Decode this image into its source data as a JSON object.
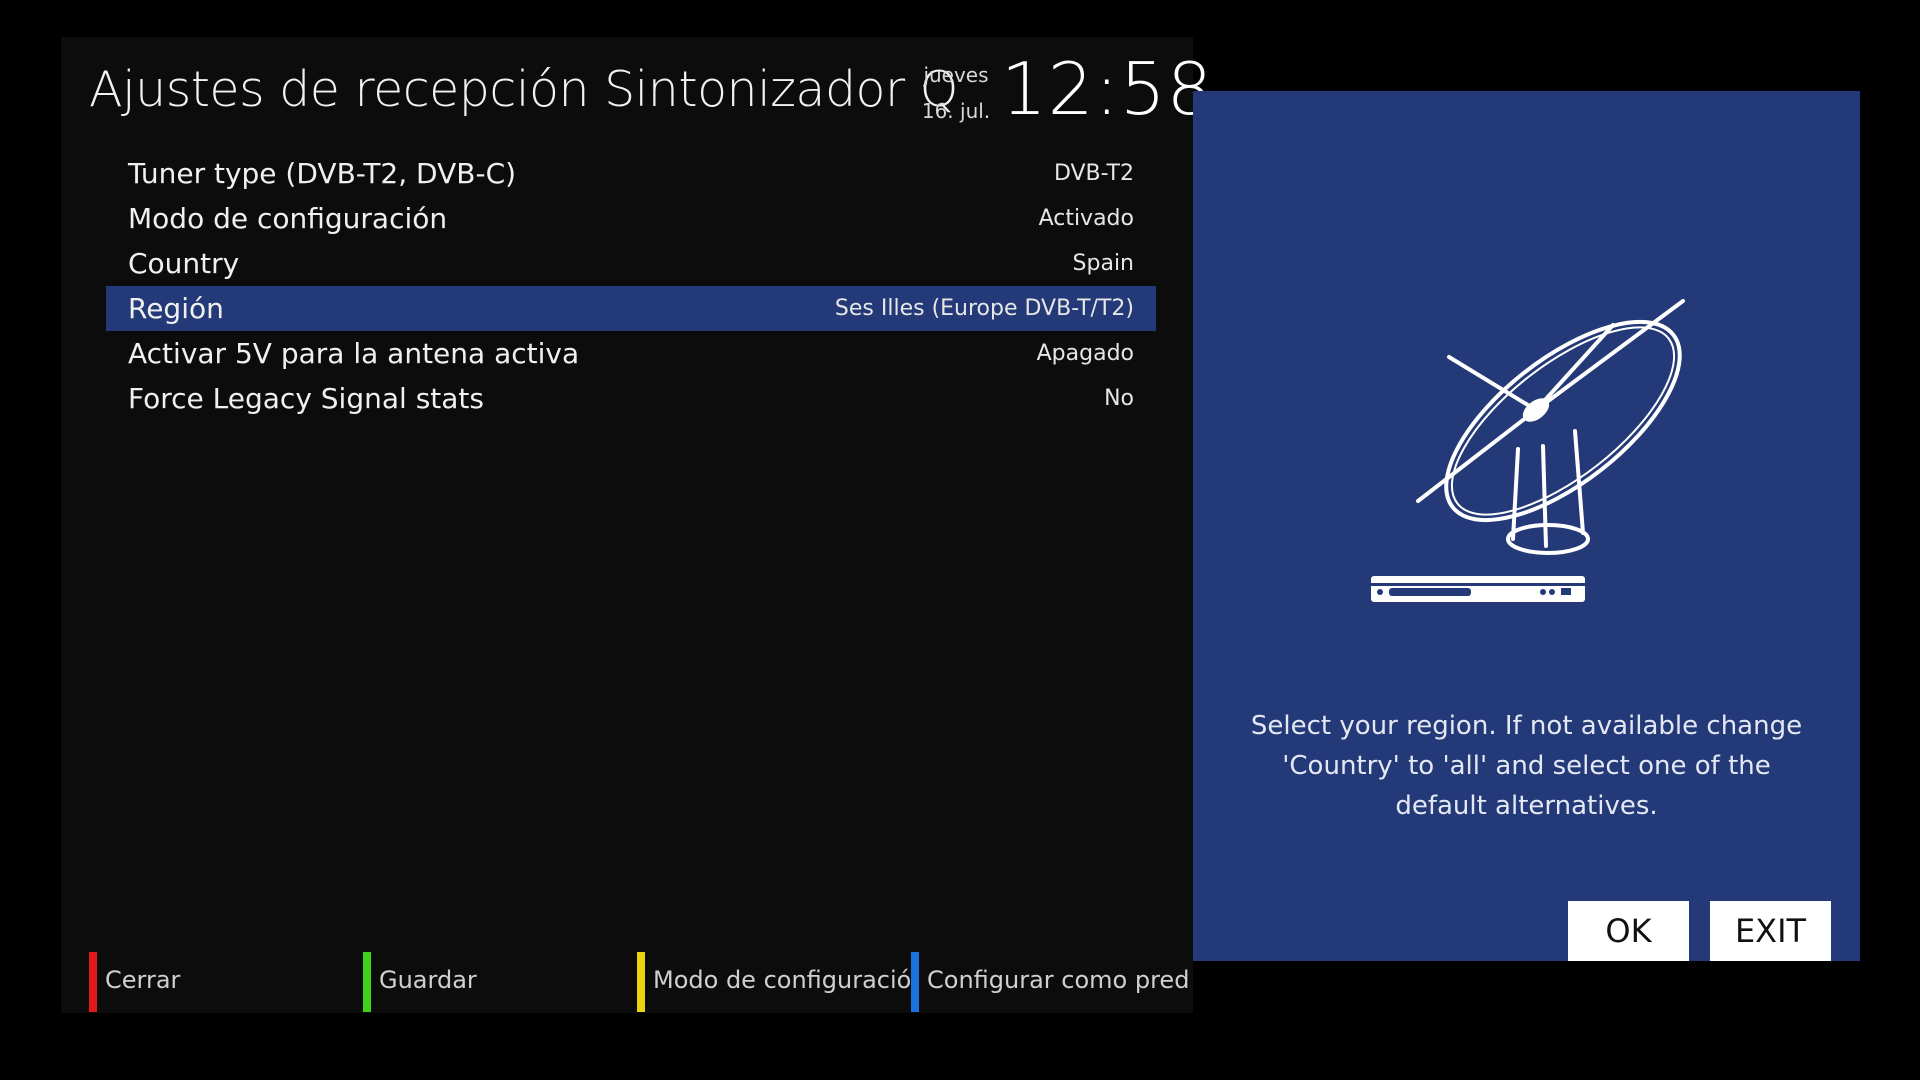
{
  "header": {
    "title": "Ajustes de recepción Sintonizador Q",
    "day": "jueves",
    "date": "16. jul.",
    "time": "12:58"
  },
  "settings": [
    {
      "label": "Tuner type (DVB-T2, DVB-C)",
      "value": "DVB-T2",
      "selected": false
    },
    {
      "label": "Modo de configuración",
      "value": "Activado",
      "selected": false
    },
    {
      "label": "Country",
      "value": "Spain",
      "selected": false
    },
    {
      "label": "Región",
      "value": "Ses Illes (Europe DVB-T/T2)",
      "selected": true
    },
    {
      "label": "Activar 5V para la antena activa",
      "value": "Apagado",
      "selected": false
    },
    {
      "label": "Force Legacy Signal stats",
      "value": "No",
      "selected": false
    }
  ],
  "footer": {
    "keys": [
      {
        "label": "Cerrar",
        "color": "#e01a1a"
      },
      {
        "label": "Guardar",
        "color": "#3fd21a"
      },
      {
        "label": "Modo de configuración",
        "color": "#e8d40f"
      },
      {
        "label": "Configurar como predeterminado",
        "color": "#1a73e0"
      }
    ]
  },
  "help": {
    "text": "Select your region. If not available change 'Country' to 'all' and select one of the default alternatives.",
    "illustration_icon": "satellite-dish-receiver-icon",
    "ok_label": "OK",
    "exit_label": "EXIT"
  },
  "colors": {
    "background": "#000000",
    "panel": "#0c0c0c",
    "accent": "#243a78",
    "text": "#f0f0f0"
  }
}
